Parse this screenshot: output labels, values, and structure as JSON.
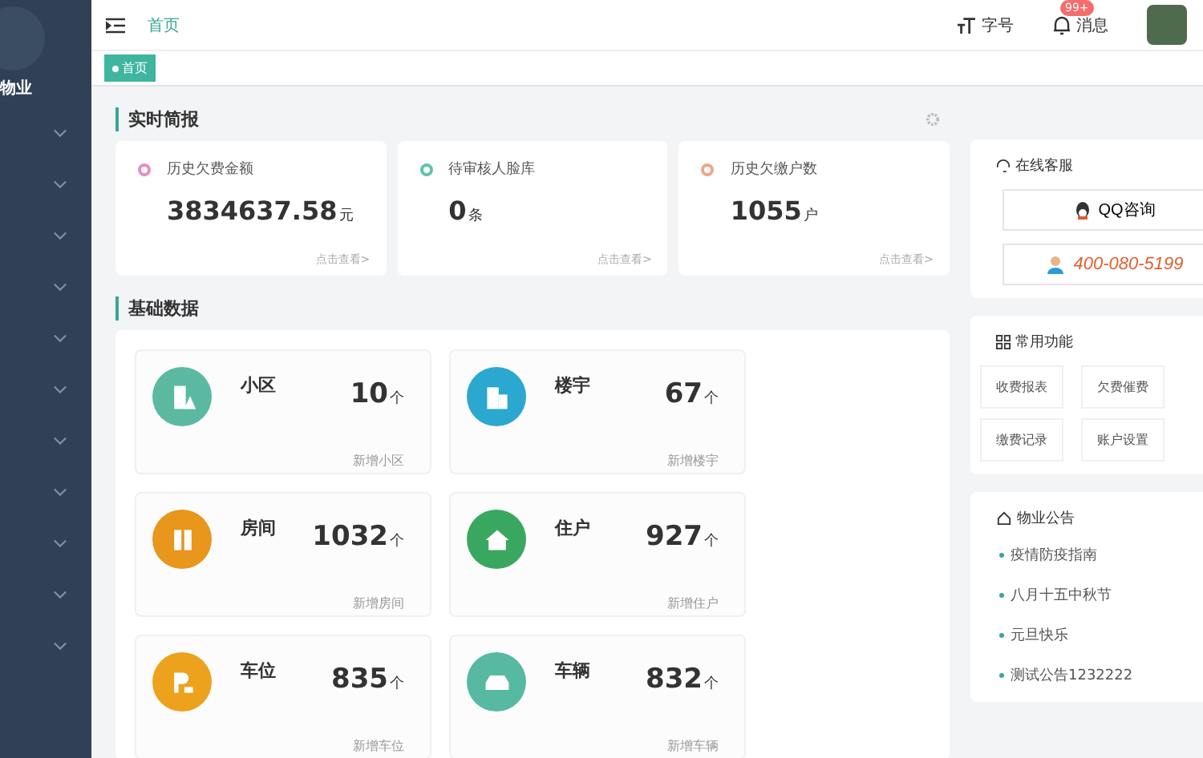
{
  "sidebar": {
    "brand": "物业",
    "items": [
      {
        "expanded": false
      },
      {
        "expanded": false
      },
      {
        "expanded": false
      },
      {
        "expanded": false
      },
      {
        "expanded": false
      },
      {
        "expanded": false
      },
      {
        "expanded": false
      },
      {
        "expanded": false
      },
      {
        "expanded": false
      },
      {
        "expanded": false
      },
      {
        "expanded": false
      }
    ]
  },
  "header": {
    "breadcrumb": "首页",
    "font_size_label": "字号",
    "messages_label": "消息",
    "messages_badge": "99+"
  },
  "tags": [
    {
      "label": "首页",
      "selected": true
    }
  ],
  "briefing": {
    "title": "实时简报",
    "cards": [
      {
        "label": "历史欠费金额",
        "value": "3834637.58",
        "unit": "元",
        "link": "点击查看>",
        "color": "#e58fbf"
      },
      {
        "label": "待审核人脸库",
        "value": "0",
        "unit": "条",
        "link": "点击查看>",
        "color": "#5fc4a8"
      },
      {
        "label": "历史欠缴户数",
        "value": "1055",
        "unit": "户",
        "link": "点击查看>",
        "color": "#f0a58a"
      }
    ]
  },
  "basic": {
    "title": "基础数据",
    "cards": [
      {
        "kind": "estate",
        "name": "小区",
        "value": "10",
        "unit": "个",
        "footer": "新增小区",
        "color": "#5bb9a2"
      },
      {
        "kind": "building",
        "name": "楼宇",
        "value": "67",
        "unit": "个",
        "footer": "新增楼宇",
        "color": "#2aa8d0"
      },
      {
        "kind": "room",
        "name": "房间",
        "value": "1032",
        "unit": "个",
        "footer": "新增房间",
        "color": "#e8961c"
      },
      {
        "kind": "resident",
        "name": "住户",
        "value": "927",
        "unit": "个",
        "footer": "新增住户",
        "color": "#3aa761"
      },
      {
        "kind": "parking",
        "name": "车位",
        "value": "835",
        "unit": "个",
        "footer": "新增车位",
        "color": "#eca21d"
      },
      {
        "kind": "vehicle",
        "name": "车辆",
        "value": "832",
        "unit": "个",
        "footer": "新增车辆",
        "color": "#58b9a2"
      }
    ]
  },
  "service": {
    "title": "在线客服",
    "qq": "QQ咨询",
    "phone": "400-080-5199"
  },
  "functions": {
    "title": "常用功能",
    "items": [
      "收费报表",
      "欠费催费",
      "缴费记录",
      "账户设置"
    ]
  },
  "notices": {
    "title": "物业公告",
    "items": [
      "疫情防疫指南",
      "八月十五中秋节",
      "元旦快乐",
      "测试公告1232222"
    ]
  }
}
